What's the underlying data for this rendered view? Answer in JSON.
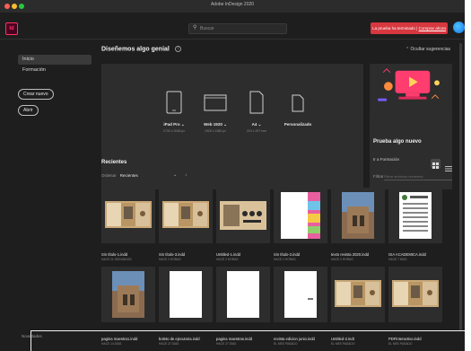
{
  "window": {
    "title": "Adobe InDesign 2020"
  },
  "appbar": {
    "logo": "Id",
    "search_placeholder": "Buscar",
    "trial_text": "La prueba ha terminado |",
    "trial_link": "Comprar ahora"
  },
  "sidebar": {
    "items": [
      {
        "label": "Inicio"
      },
      {
        "label": "Formación"
      }
    ],
    "create_new": "Crear nuevo",
    "open": "Abrir",
    "news": "Novedades"
  },
  "hero": {
    "title": "Diseñemos algo genial",
    "hide_suggestions": "Ocultar sugerencias"
  },
  "presets": [
    {
      "name": "iPad Pro",
      "size": "2732 x 2048 px"
    },
    {
      "name": "Web 1920",
      "size": "1920 x 1080 px"
    },
    {
      "name": "A4",
      "size": "210 x 297 mm"
    },
    {
      "name": "Personalizado",
      "size": ""
    }
  ],
  "promo": {
    "title": "Prueba algo nuevo",
    "link": "Ir a Formación"
  },
  "recent": {
    "title": "Recientes",
    "sort_label": "Ordenar",
    "sort_value": "Recientes",
    "filter_label": "Filtrar",
    "filter_placeholder": "Filtrar archivos recientes"
  },
  "files": [
    {
      "name": "Sin título-1.indd",
      "date": "HACE 21 SEGUNDOS",
      "thumb": "brochure"
    },
    {
      "name": "Sin título-3.indd",
      "date": "HACE 2 HORAS",
      "thumb": "brochure"
    },
    {
      "name": "Untitled-1.indd",
      "date": "HACE 2 HORAS",
      "thumb": "brochure-icons"
    },
    {
      "name": "Sin título-2.indd",
      "date": "HACE 2 HORAS",
      "thumb": "colorful"
    },
    {
      "name": "texto revista 2020.indd",
      "date": "HACE 2 HORAS",
      "thumb": "ruins"
    },
    {
      "name": "GIA ACADEMICA.indd",
      "date": "HACE 7 DÍAS",
      "thumb": "form"
    },
    {
      "name": "pagina maestra1.indd",
      "date": "HACE 14 DÍAS",
      "thumb": "ruins-portrait"
    },
    {
      "name": "boleto de ejecutoria.indd",
      "date": "HACE 27 DÍAS",
      "thumb": "blank"
    },
    {
      "name": "pagina maestras.indd",
      "date": "HACE 27 DÍAS",
      "thumb": "blank"
    },
    {
      "name": "revista edicion junio.indd",
      "date": "EL MES PASADO",
      "thumb": "blank-mark"
    },
    {
      "name": "Untitled-2.indt",
      "date": "EL MES PASADO",
      "thumb": "brochure"
    },
    {
      "name": "PDFinteractivo.indd",
      "date": "EL MES PASADO",
      "thumb": "brochure"
    }
  ],
  "colors": {
    "background": "#1e1e1e",
    "panel": "#2d2d2d",
    "accent": "#ff3366",
    "trial": "#d7373f",
    "avatar": "#1473e6"
  }
}
